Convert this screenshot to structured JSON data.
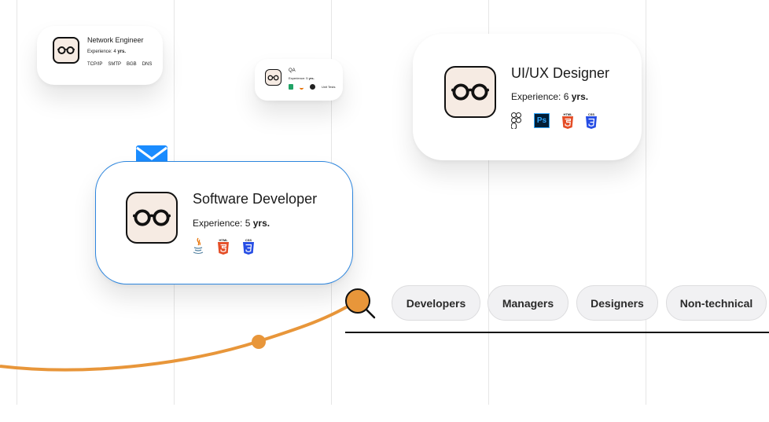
{
  "cards": {
    "network": {
      "title": "Network Engineer",
      "exp_prefix": "Experience: 4",
      "exp_unit": "yrs.",
      "skills": [
        "TCP/IP",
        "SMTP",
        "BGB",
        "DNS"
      ]
    },
    "qa": {
      "title": "QA",
      "exp_prefix": "Experience: 5",
      "exp_unit": "yrs.",
      "tool_label": "Unit Tests"
    },
    "uiux": {
      "title": "UI/UX Designer",
      "exp_prefix": "Experience: 6",
      "exp_unit": "yrs.",
      "ps_label": "Ps",
      "html_label": "HTML",
      "css_label": "CSS"
    },
    "developer": {
      "title": "Software Developer",
      "exp_prefix": "Experience: 5",
      "exp_unit": "yrs.",
      "html_label": "HTML",
      "css_label": "CSS"
    }
  },
  "filters": [
    "Developers",
    "Managers",
    "Designers",
    "Non-technical"
  ],
  "colors": {
    "accent_orange": "#e8963a",
    "mail_blue": "#1a8cff",
    "card_border_blue": "#2e86de",
    "html_orange": "#e44d26",
    "css_blue": "#264de4",
    "ps_blue": "#31a8ff"
  },
  "icons": [
    "glasses-avatar-icon",
    "mail-icon",
    "search-magnifier-icon",
    "figma-icon",
    "photoshop-icon",
    "html5-icon",
    "css3-icon",
    "java-icon"
  ]
}
